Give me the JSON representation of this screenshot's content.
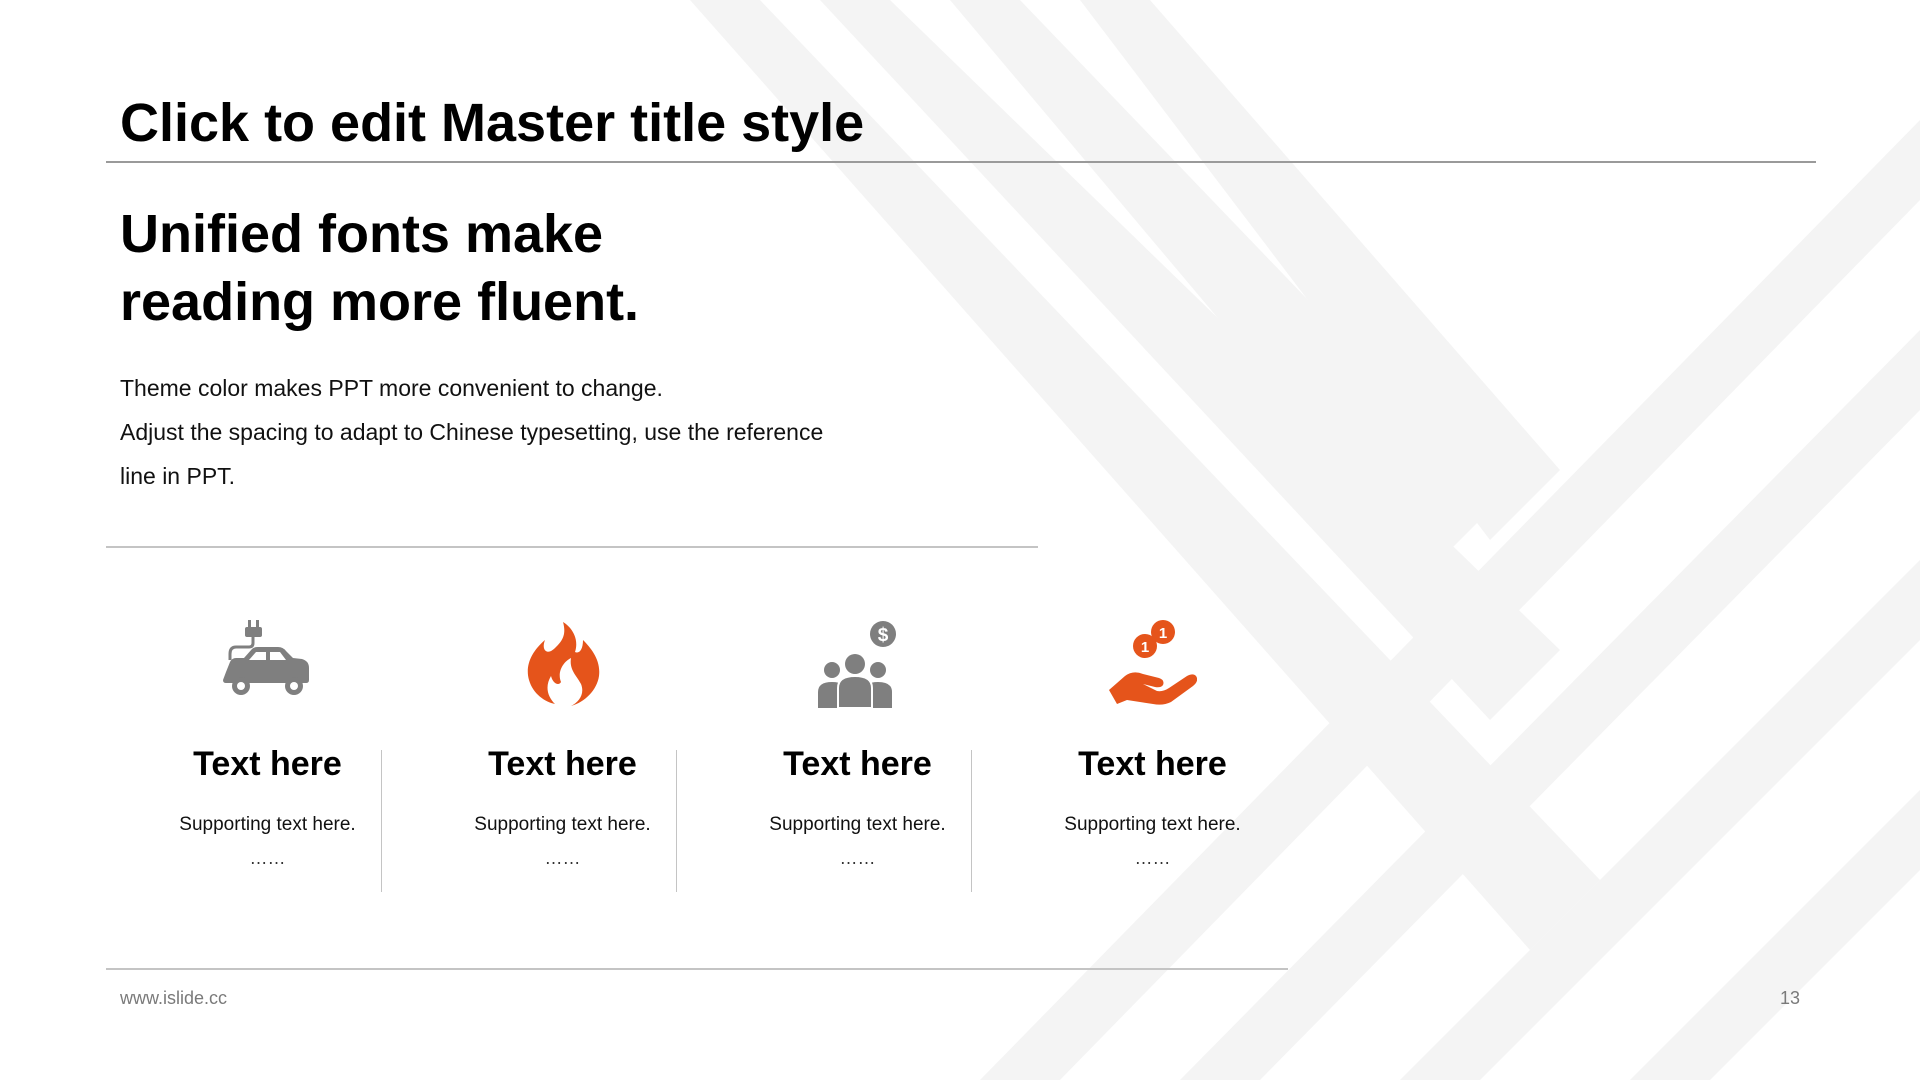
{
  "slide": {
    "title": "Click to edit Master title style",
    "heading_lines": [
      "Unified fonts make",
      "reading more fluent."
    ],
    "body_lines": [
      "Theme color makes PPT more convenient to change.",
      "Adjust the spacing to adapt to Chinese typesetting, use the reference",
      "line in PPT."
    ],
    "features": [
      {
        "icon": "electric-car-icon",
        "color": "#7f7f7f",
        "title": "Text here",
        "subtitle": "Supporting  text here.",
        "dots": "……"
      },
      {
        "icon": "flame-icon",
        "color": "#e5541b",
        "title": "Text here",
        "subtitle": "Supporting  text here.",
        "dots": "……"
      },
      {
        "icon": "people-money-icon",
        "color": "#7f7f7f",
        "title": "Text here",
        "subtitle": "Supporting  text here.",
        "dots": "……"
      },
      {
        "icon": "hand-coins-icon",
        "color": "#e5541b",
        "title": "Text here",
        "subtitle": "Supporting  text here.",
        "dots": "……"
      }
    ],
    "footer": {
      "url": "www.islide.cc",
      "page_number": "13"
    },
    "colors": {
      "accent": "#e5541b",
      "icon_gray": "#7f7f7f",
      "rule": "#9a9a9a"
    }
  }
}
